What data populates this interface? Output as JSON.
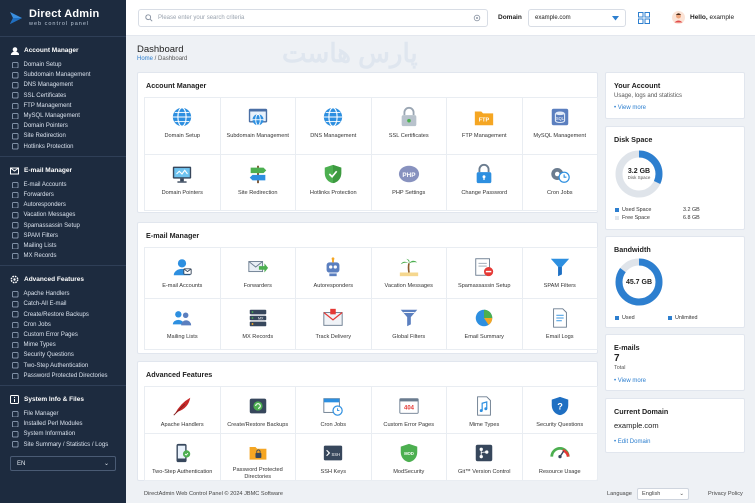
{
  "brand": {
    "title": "Direct Admin",
    "subtitle": "web control panel"
  },
  "sidebar": {
    "sections": [
      {
        "title": "Account Manager",
        "items": [
          "Domain Setup",
          "Subdomain Management",
          "DNS Management",
          "SSL Certificates",
          "FTP Management",
          "MySQL Management",
          "Domain Pointers",
          "Site Redirection",
          "Hotlinks Protection"
        ]
      },
      {
        "title": "E-mail Manager",
        "items": [
          "E-mail Accounts",
          "Forwarders",
          "Autoresponders",
          "Vacation Messages",
          "Spamassassin Setup",
          "SPAM Filters",
          "Mailing Lists",
          "MX Records"
        ]
      },
      {
        "title": "Advanced Features",
        "items": [
          "Apache Handlers",
          "Catch-All E-mail",
          "Create/Restore Backups",
          "Cron Jobs",
          "Custom Error Pages",
          "Mime Types",
          "Security Questions",
          "Two-Step Authentication",
          "Password Protected Directories"
        ]
      },
      {
        "title": "System Info & Files",
        "items": [
          "File Manager",
          "Installed Perl Modules",
          "System Information",
          "Site Summary / Statistics / Logs"
        ]
      }
    ],
    "language": "EN"
  },
  "topbar": {
    "search_placeholder": "Please enter your search criteria",
    "domain_label": "Domain",
    "domain_value": "example.com",
    "greeting": "Hello,",
    "username": "example"
  },
  "page": {
    "title": "Dashboard",
    "breadcrumb_home": "Home",
    "breadcrumb_sep": " / ",
    "breadcrumb_current": "Dashboard",
    "watermark": "پارس هاست"
  },
  "account_manager": {
    "title": "Account Manager",
    "tiles": [
      {
        "label": "Domain Setup",
        "icon": "globe-icon"
      },
      {
        "label": "Subdomain Management",
        "icon": "browser-globe-icon"
      },
      {
        "label": "DNS Management",
        "icon": "globe-icon"
      },
      {
        "label": "SSL Certificates",
        "icon": "lock-icon"
      },
      {
        "label": "FTP Management",
        "icon": "ftp-folder-icon"
      },
      {
        "label": "MySQL Management",
        "icon": "database-icon"
      },
      {
        "label": "Domain Pointers",
        "icon": "monitor-icon"
      },
      {
        "label": "Site Redirection",
        "icon": "signpost-icon"
      },
      {
        "label": "Hotlinks Protection",
        "icon": "shield-icon"
      },
      {
        "label": "PHP Settings",
        "icon": "php-icon"
      },
      {
        "label": "Change Password",
        "icon": "padlock-icon"
      },
      {
        "label": "Cron Jobs",
        "icon": "gear-clock-icon"
      }
    ]
  },
  "email_manager": {
    "title": "E-mail Manager",
    "tiles": [
      {
        "label": "E-mail Accounts",
        "icon": "user-icon"
      },
      {
        "label": "Forwarders",
        "icon": "forward-mail-icon"
      },
      {
        "label": "Autoresponders",
        "icon": "robot-icon"
      },
      {
        "label": "Vacation Messages",
        "icon": "palm-icon"
      },
      {
        "label": "Spamassassin Setup",
        "icon": "spam-icon"
      },
      {
        "label": "SPAM Filters",
        "icon": "funnel-icon"
      },
      {
        "label": "Mailing Lists",
        "icon": "people-icon"
      },
      {
        "label": "MX Records",
        "icon": "server-icon"
      },
      {
        "label": "Track Delivery",
        "icon": "envelope-icon"
      },
      {
        "label": "Global Filters",
        "icon": "filter-icon"
      },
      {
        "label": "Email Summary",
        "icon": "pie-icon"
      },
      {
        "label": "Email Logs",
        "icon": "document-icon"
      }
    ]
  },
  "advanced_features": {
    "title": "Advanced Features",
    "tiles": [
      {
        "label": "Apache Handlers",
        "icon": "feather-icon"
      },
      {
        "label": "Create/Restore Backups",
        "icon": "backup-drive-icon"
      },
      {
        "label": "Cron Jobs",
        "icon": "calendar-clock-icon"
      },
      {
        "label": "Custom Error Pages",
        "icon": "error-page-icon"
      },
      {
        "label": "Mime Types",
        "icon": "music-file-icon"
      },
      {
        "label": "Security Questions",
        "icon": "question-shield-icon"
      },
      {
        "label": "Two-Step Authentication",
        "icon": "phone-icon"
      },
      {
        "label": "Password Protected Directories",
        "icon": "locked-folder-icon"
      },
      {
        "label": "SSH Keys",
        "icon": "terminal-icon"
      },
      {
        "label": "ModSecurity",
        "icon": "mod-shield-icon"
      },
      {
        "label": "Git™ Version Control",
        "icon": "git-icon"
      },
      {
        "label": "Resource Usage",
        "icon": "gauge-icon"
      }
    ]
  },
  "your_account": {
    "title": "Your Account",
    "text": "Usage, logs and statistics",
    "link": "View more"
  },
  "disk_space": {
    "title": "Disk Space",
    "center_value": "3.2 GB",
    "center_label": "Disk Space",
    "used_label": "Used Space",
    "used_value": "3.2 GB",
    "free_label": "Free Space",
    "free_value": "6.8 GB",
    "used_fraction": 0.32,
    "used_color": "#2d7fcf",
    "free_color": "#dfe4ea"
  },
  "bandwidth": {
    "title": "Bandwidth",
    "center_value": "45.7 GB",
    "used_label": "Used",
    "unlimited_label": "Unlimited",
    "used_fraction": 0.85
  },
  "emails": {
    "title": "E-mails",
    "count": "7",
    "total_label": "Total",
    "link": "View more"
  },
  "current_domain": {
    "title": "Current Domain",
    "domain": "example.com",
    "link": "Edit Domain"
  },
  "footer": {
    "copyright": "DirectAdmin Web Control Panel © 2024 JBMC Software",
    "language_label": "Language",
    "language_value": "English",
    "privacy": "Privacy Policy"
  },
  "colors": {
    "sidebar_bg": "#1d2b3f",
    "accent": "#2d7fcf"
  }
}
